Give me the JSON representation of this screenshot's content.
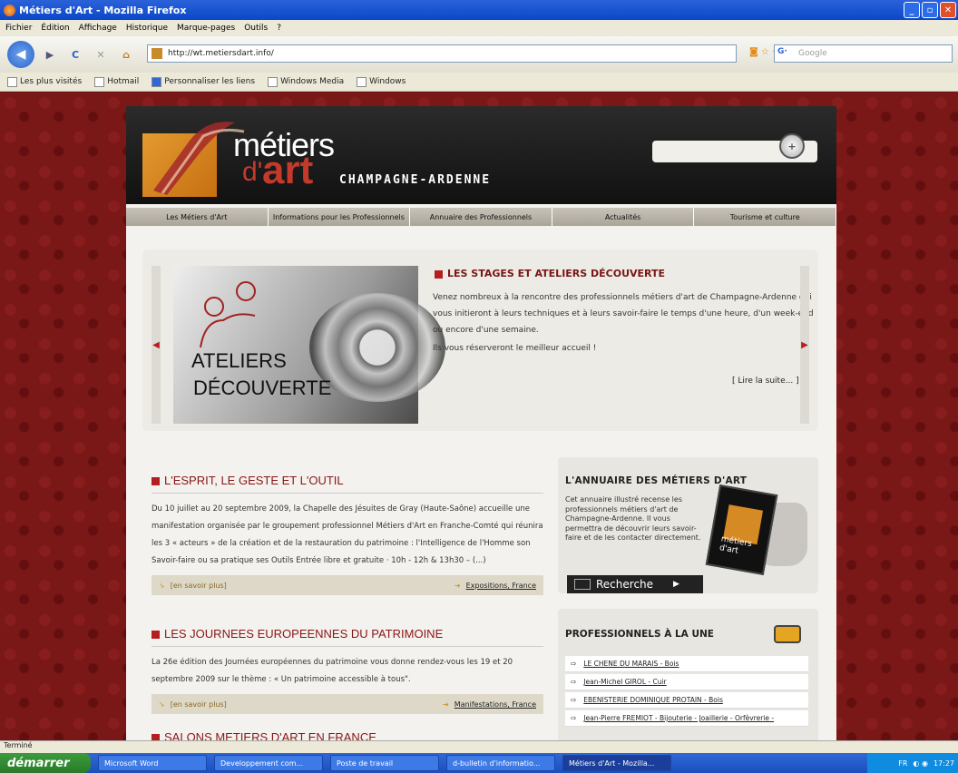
{
  "window": {
    "title": "Métiers d'Art - Mozilla Firefox"
  },
  "menu": [
    "Fichier",
    "Édition",
    "Affichage",
    "Historique",
    "Marque-pages",
    "Outils",
    "?"
  ],
  "urlbar": {
    "value": "http://wt.metiersdart.info/"
  },
  "search_engine": {
    "placeholder": "Google"
  },
  "bookmarks": [
    "Les plus visités",
    "Hotmail",
    "Personnaliser les liens",
    "Windows Media",
    "Windows"
  ],
  "site": {
    "logo": {
      "line1": "métiers",
      "d": "d'",
      "art": "art",
      "region": "CHAMPAGNE-ARDENNE"
    },
    "nav": [
      "Les Métiers d'Art",
      "Informations pour les Professionnels",
      "Annuaire des Professionnels",
      "Actualités",
      "Tourisme et culture"
    ],
    "slider": {
      "image_line1": "ATELIERS",
      "image_line2": "DÉCOUVERTE",
      "title": "LES STAGES ET ATELIERS DÉCOUVERTE",
      "text": "Venez nombreux à la rencontre des professionnels métiers d'art de Champagne-Ardenne qui vous initieront à leurs techniques et à leurs savoir-faire le temps d'une heure, d'un week-end ou encore d'une semaine.",
      "text2": "Ils vous réserveront le meilleur accueil !",
      "more": "[ Lire la suite... ]"
    },
    "articles": [
      {
        "title": "L'ESPRIT, LE GESTE ET L'OUTIL",
        "text": "Du 10 juillet au 20 septembre 2009, la Chapelle des Jésuites de Gray (Haute-Saône) accueille une manifestation organisée par le groupement professionnel Métiers d'Art en Franche-Comté qui réunira les 3 « acteurs » de la création et de la restauration du patrimoine : l'Intelligence de l'Homme son Savoir-faire ou sa pratique ses Outils Entrée libre et gratuite · 10h - 12h & 13h30 – (...)",
        "more": "[en savoir plus]",
        "tags": "Expositions, France"
      },
      {
        "title": "LES JOURNEES EUROPEENNES DU PATRIMOINE",
        "text": "La 26e édition des Journées européennes du patrimoine vous donne rendez-vous les 19 et 20 septembre 2009 sur le thème : « Un patrimoine accessible à tous\".",
        "more": "[en savoir plus]",
        "tags": "Manifestations, France"
      },
      {
        "title": "SALONS METIERS D'ART EN FRANCE"
      }
    ],
    "annuaire": {
      "title": "L'ANNUAIRE DES MÉTIERS D'ART",
      "text": "Cet annuaire illustré recense les professionnels métiers d'art de Champagne-Ardenne. Il vous permettra de découvrir leurs savoir-faire et de les contacter directement.",
      "button": "Recherche",
      "book_label": "métiers d'art"
    },
    "pros": {
      "title": "PROFESSIONNELS À LA UNE",
      "items": [
        "LE CHENE DU MARAIS - Bois",
        "Jean-Michel GIROL - Cuir",
        "EBENISTERIE DOMINIQUE PROTAIN - Bois",
        "Jean-Pierre FREMIOT - Bijouterie - Joaillerie - Orfèvrerie -"
      ]
    }
  },
  "status": "Terminé",
  "taskbar": {
    "start": "démarrer",
    "items": [
      "Microsoft Word",
      "Developpement com...",
      "Poste de travail",
      "d-bulletin d'informatio...",
      "Métiers d'Art - Mozilla..."
    ],
    "tray": {
      "lang": "FR",
      "time": "17:27"
    }
  }
}
